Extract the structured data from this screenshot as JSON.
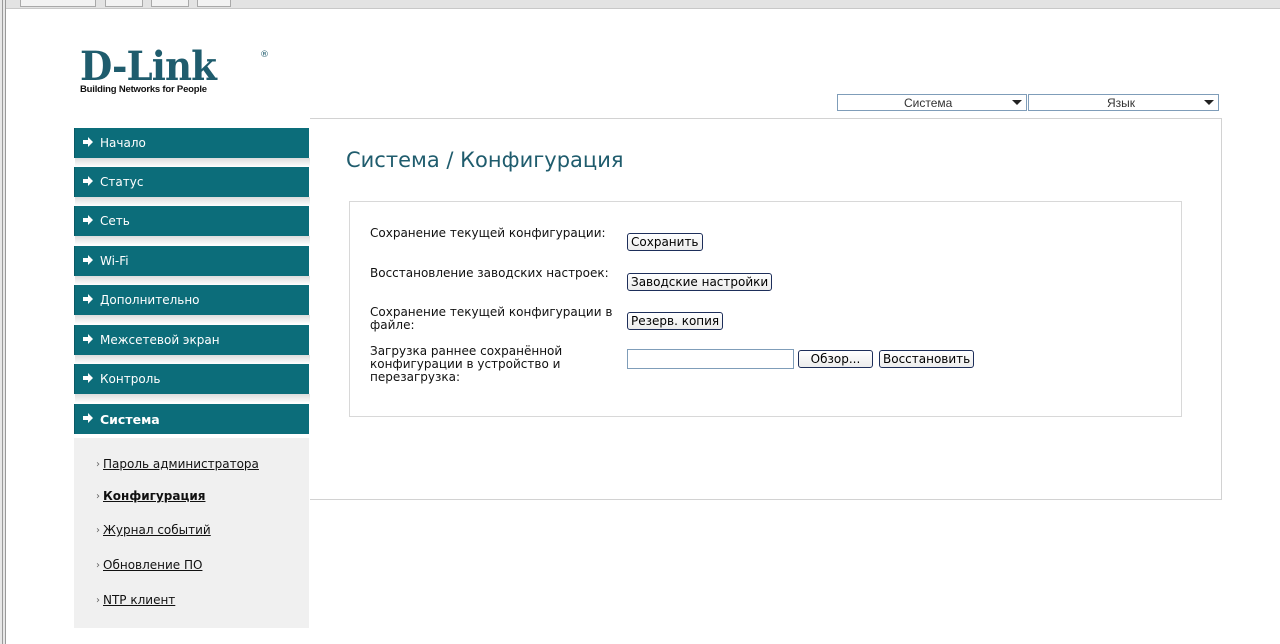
{
  "brand": {
    "logo": "D-Link",
    "registered": "®",
    "tagline": "Building Networks for People"
  },
  "top_menu": {
    "system": {
      "label": "Система"
    },
    "language": {
      "label": "Язык"
    }
  },
  "nav": {
    "items": [
      {
        "label": "Начало"
      },
      {
        "label": "Статус"
      },
      {
        "label": "Сеть"
      },
      {
        "label": "Wi-Fi"
      },
      {
        "label": "Дополнительно"
      },
      {
        "label": "Межсетевой экран"
      },
      {
        "label": "Контроль"
      },
      {
        "label": "Система",
        "active": true
      }
    ],
    "subitems": [
      {
        "label": "Пароль администратора"
      },
      {
        "label": "Конфигурация",
        "active": true
      },
      {
        "label": "Журнал событий"
      },
      {
        "label": "Обновление ПО"
      },
      {
        "label": "NTP клиент"
      }
    ]
  },
  "main": {
    "title": "Система / Конфигурация",
    "rows": [
      {
        "label": "Сохранение текущей конфигурации:",
        "button": "Сохранить"
      },
      {
        "label": "Восстановление заводских настроек:",
        "button": "Заводские настройки"
      },
      {
        "label": "Сохранение текущей конфигурации в файле:",
        "button": "Резерв. копия"
      },
      {
        "label": "Загрузка раннее сохранённой конфигурации в устройство и перезагрузка:",
        "file_value": "",
        "browse_button": "Обзор...",
        "restore_button": "Восстановить"
      }
    ]
  },
  "colors": {
    "accent": "#0c6d7a",
    "title": "#1f5c6d"
  }
}
